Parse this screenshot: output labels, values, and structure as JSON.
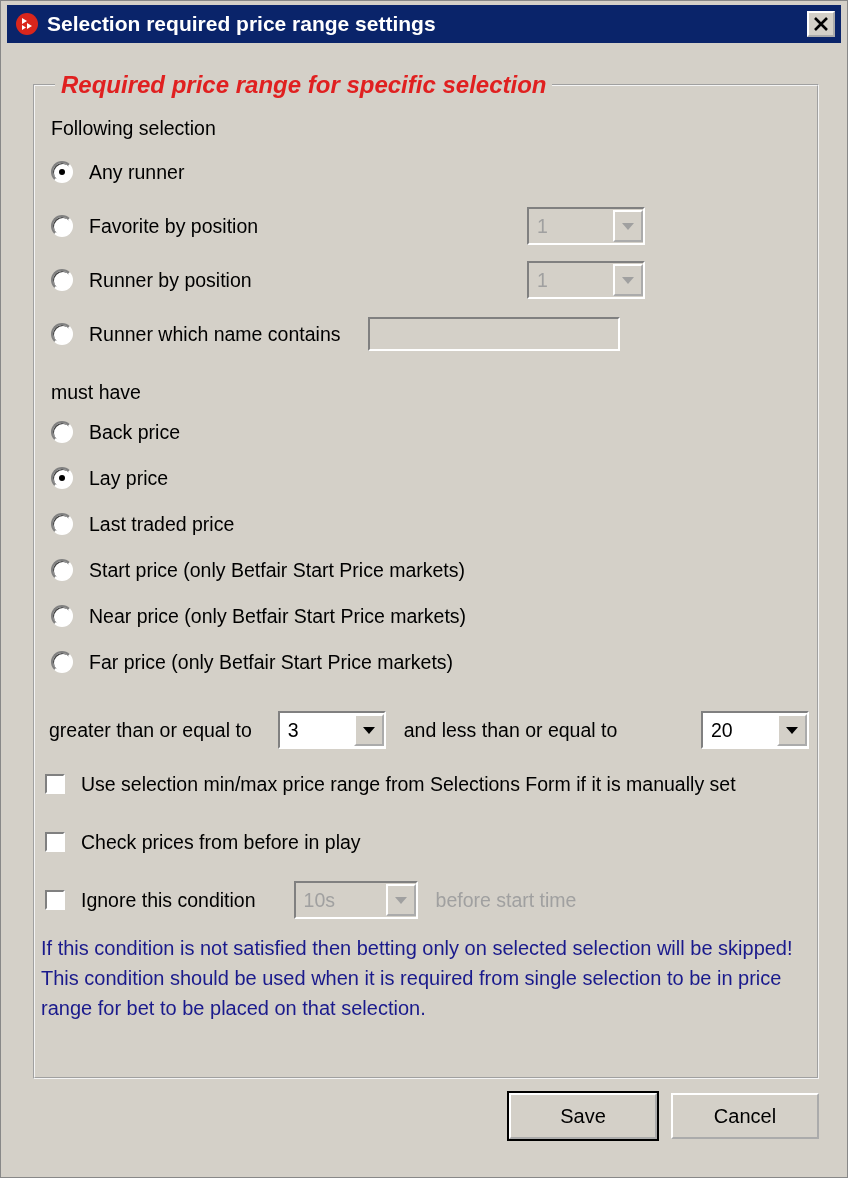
{
  "window": {
    "title": "Selection required price range settings"
  },
  "group": {
    "title": "Required price range for specific selection"
  },
  "following_label": "Following selection",
  "selection_options": [
    {
      "label": "Any runner",
      "selected": true,
      "kind": "plain"
    },
    {
      "label": "Favorite by position",
      "selected": false,
      "kind": "dropdown",
      "value": "1",
      "disabled": true
    },
    {
      "label": "Runner by position",
      "selected": false,
      "kind": "dropdown",
      "value": "1",
      "disabled": true
    },
    {
      "label": "Runner which name contains",
      "selected": false,
      "kind": "text",
      "disabled": true
    }
  ],
  "must_have_label": "must have",
  "price_options": [
    {
      "label": "Back price",
      "selected": false
    },
    {
      "label": "Lay price",
      "selected": true
    },
    {
      "label": "Last traded price",
      "selected": false
    },
    {
      "label": "Start price (only Betfair Start Price markets)",
      "selected": false
    },
    {
      "label": "Near price (only Betfair Start Price markets)",
      "selected": false
    },
    {
      "label": "Far price (only Betfair Start Price markets)",
      "selected": false
    }
  ],
  "range": {
    "min_label": "greater than or equal to",
    "min_value": "3",
    "max_label": "and less than or equal to",
    "max_value": "20"
  },
  "checkboxes": [
    {
      "label": "Use selection min/max price range from Selections Form if it is manually set",
      "checked": false,
      "kind": "plain"
    },
    {
      "label": "Check prices from before in play",
      "checked": false,
      "kind": "plain"
    },
    {
      "label": "Ignore this condition",
      "checked": false,
      "kind": "timed",
      "value": "10s",
      "disabled": true,
      "suffix": "before start time"
    }
  ],
  "note": "If this condition is not satisfied then betting only on selected selection will be skipped! This condition should be used when it is required from single selection to be in price range for bet to be placed on that selection.",
  "buttons": [
    {
      "label": "Save",
      "kind": "default"
    },
    {
      "label": "Cancel",
      "kind": "normal"
    }
  ]
}
